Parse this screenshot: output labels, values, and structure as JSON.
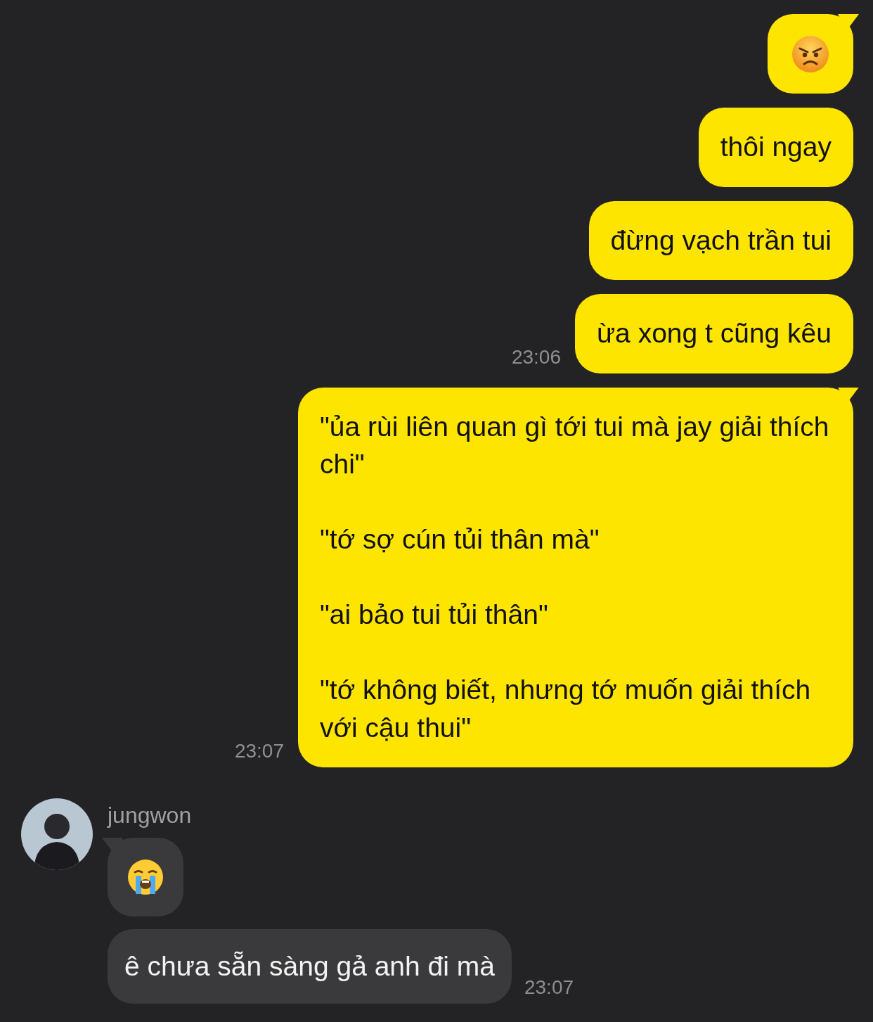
{
  "messages": [
    {
      "outgoing": true,
      "kind": "angry",
      "tail": true
    },
    {
      "outgoing": true,
      "kind": "text",
      "text": "thôi ngay",
      "tail": false
    },
    {
      "outgoing": true,
      "kind": "text",
      "text": "đừng vạch trần tui",
      "tail": false
    },
    {
      "outgoing": true,
      "kind": "text",
      "text": "ừa xong t cũng kêu",
      "time": "23:06",
      "tail": false
    },
    {
      "outgoing": true,
      "kind": "text",
      "text": "\"ủa rùi liên quan gì tới tui mà jay giải thích chi\"\n\n\"tớ sợ cún tủi thân mà\"\n\n\"ai bảo tui tủi thân\"\n\n\"tớ không biết, nhưng tớ muốn giải thích với cậu thui\"",
      "time": "23:07",
      "tail": true
    },
    {
      "outgoing": false,
      "name": "jungwon",
      "kind": "crying",
      "tail": true
    },
    {
      "outgoing": false,
      "kind": "text",
      "text": "ê chưa sẵn sàng gả anh đi mà",
      "time": "23:07",
      "tail": false
    }
  ]
}
